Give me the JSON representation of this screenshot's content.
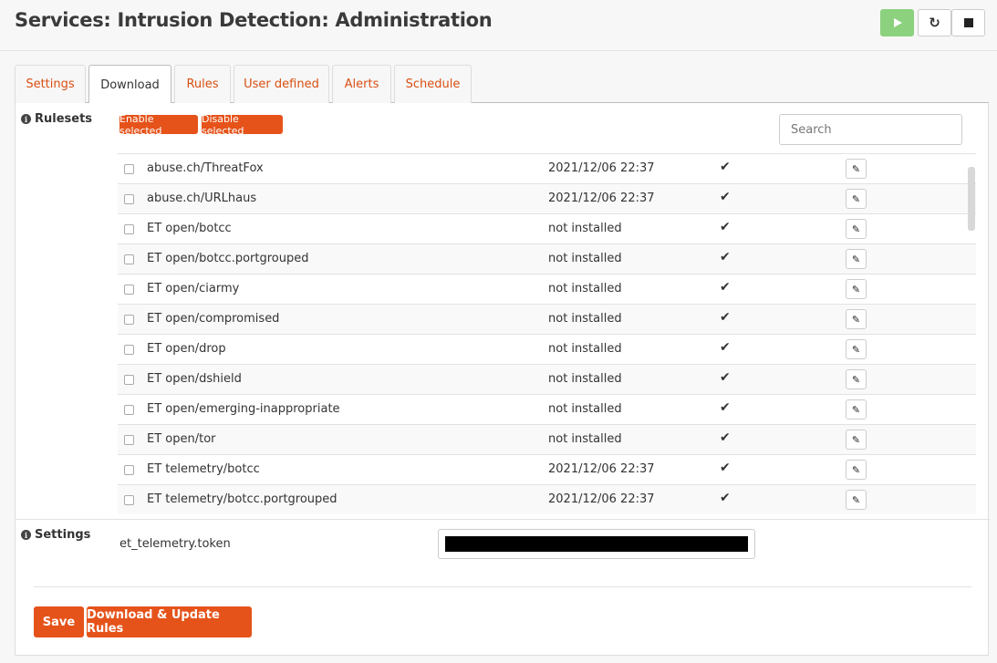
{
  "header": {
    "title": "Services: Intrusion Detection: Administration",
    "start_icon": "play-icon",
    "restart_icon": "reload-icon",
    "stop_icon": "stop-icon",
    "start_color": "#8cd17d"
  },
  "tabs": [
    {
      "label": "Settings",
      "active": false
    },
    {
      "label": "Download",
      "active": true
    },
    {
      "label": "Rules",
      "active": false
    },
    {
      "label": "User defined",
      "active": false
    },
    {
      "label": "Alerts",
      "active": false
    },
    {
      "label": "Schedule",
      "active": false
    }
  ],
  "rulesets": {
    "section_label": "Rulesets",
    "enable_label": "Enable selected",
    "disable_label": "Disable selected",
    "search_placeholder": "Search",
    "rows": [
      {
        "name": "abuse.ch/ThreatFox",
        "date": "2021/12/06 22:37",
        "enabled": "✔",
        "edit_icon": "pencil-icon"
      },
      {
        "name": "abuse.ch/URLhaus",
        "date": "2021/12/06 22:37",
        "enabled": "✔",
        "edit_icon": "pencil-icon"
      },
      {
        "name": "ET open/botcc",
        "date": "not installed",
        "enabled": "✔",
        "edit_icon": "pencil-icon"
      },
      {
        "name": "ET open/botcc.portgrouped",
        "date": "not installed",
        "enabled": "✔",
        "edit_icon": "pencil-icon"
      },
      {
        "name": "ET open/ciarmy",
        "date": "not installed",
        "enabled": "✔",
        "edit_icon": "pencil-icon"
      },
      {
        "name": "ET open/compromised",
        "date": "not installed",
        "enabled": "✔",
        "edit_icon": "pencil-icon"
      },
      {
        "name": "ET open/drop",
        "date": "not installed",
        "enabled": "✔",
        "edit_icon": "pencil-icon"
      },
      {
        "name": "ET open/dshield",
        "date": "not installed",
        "enabled": "✔",
        "edit_icon": "pencil-icon"
      },
      {
        "name": "ET open/emerging-inappropriate",
        "date": "not installed",
        "enabled": "✔",
        "edit_icon": "pencil-icon"
      },
      {
        "name": "ET open/tor",
        "date": "not installed",
        "enabled": "✔",
        "edit_icon": "pencil-icon"
      },
      {
        "name": "ET telemetry/botcc",
        "date": "2021/12/06 22:37",
        "enabled": "✔",
        "edit_icon": "pencil-icon"
      },
      {
        "name": "ET telemetry/botcc.portgrouped",
        "date": "2021/12/06 22:37",
        "enabled": "✔",
        "edit_icon": "pencil-icon"
      }
    ]
  },
  "settings": {
    "section_label": "Settings",
    "token_label": "et_telemetry.token",
    "token_value": ""
  },
  "actions": {
    "save_label": "Save",
    "download_label": "Download & Update Rules"
  },
  "colors": {
    "accent": "#e5531a",
    "tab_link": "#d94f12"
  }
}
